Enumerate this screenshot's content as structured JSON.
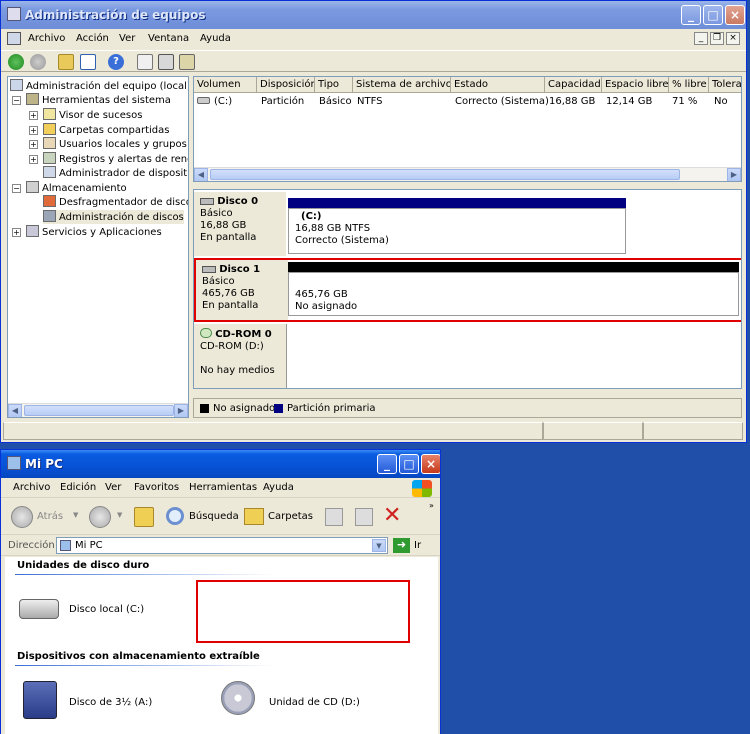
{
  "mgmt": {
    "title": "Administración de equipos",
    "menu": [
      "Archivo",
      "Acción",
      "Ver",
      "Ventana",
      "Ayuda"
    ],
    "tree": [
      {
        "label": "Administración del equipo (local)"
      },
      {
        "label": "Herramientas del sistema"
      },
      {
        "label": "Visor de sucesos"
      },
      {
        "label": "Carpetas compartidas"
      },
      {
        "label": "Usuarios locales y grupos"
      },
      {
        "label": "Registros y alertas de rendim"
      },
      {
        "label": "Administrador de dispositivos"
      },
      {
        "label": "Almacenamiento"
      },
      {
        "label": "Desfragmentador de disco"
      },
      {
        "label": "Administración de discos"
      },
      {
        "label": "Servicios y Aplicaciones"
      }
    ],
    "columns": [
      "Volumen",
      "Disposición",
      "Tipo",
      "Sistema de archivos",
      "Estado",
      "Capacidad",
      "Espacio libre",
      "% libre",
      "Tolerar"
    ],
    "volume_row": [
      "(C:)",
      "Partición",
      "Básico",
      "NTFS",
      "Correcto (Sistema)",
      "16,88 GB",
      "12,14 GB",
      "71 %",
      "No"
    ],
    "disks": [
      {
        "name": "Disco 0",
        "type": "Básico",
        "size": "16,88 GB",
        "state": "En pantalla",
        "part_name": "(C:)",
        "part_size": "16,88 GB NTFS",
        "part_status": "Correcto (Sistema)"
      },
      {
        "name": "Disco 1",
        "type": "Básico",
        "size": "465,76 GB",
        "state": "En pantalla",
        "part_size": "465,76 GB",
        "part_status": "No asignado"
      },
      {
        "name": "CD-ROM 0",
        "type": "CD-ROM (D:)",
        "state": "No hay medios"
      }
    ],
    "legend": {
      "unallocated": "No asignado",
      "primary": "Partición primaria"
    },
    "colors": {
      "unallocated": "#000000",
      "primary": "#000080",
      "highlight": "#e00000"
    }
  },
  "mypc": {
    "title": "Mi PC",
    "menu": [
      "Archivo",
      "Edición",
      "Ver",
      "Favoritos",
      "Herramientas",
      "Ayuda"
    ],
    "toolbar": {
      "back": "Atrás",
      "search": "Búsqueda",
      "folders": "Carpetas"
    },
    "address_label": "Dirección",
    "address_value": "Mi PC",
    "go": "Ir",
    "sections": [
      {
        "title": "Unidades de disco duro",
        "items": [
          "Disco local (C:)"
        ]
      },
      {
        "title": "Dispositivos con almacenamiento extraíble",
        "items": [
          "Disco de 3½ (A:)",
          "Unidad de CD (D:)"
        ]
      }
    ]
  }
}
